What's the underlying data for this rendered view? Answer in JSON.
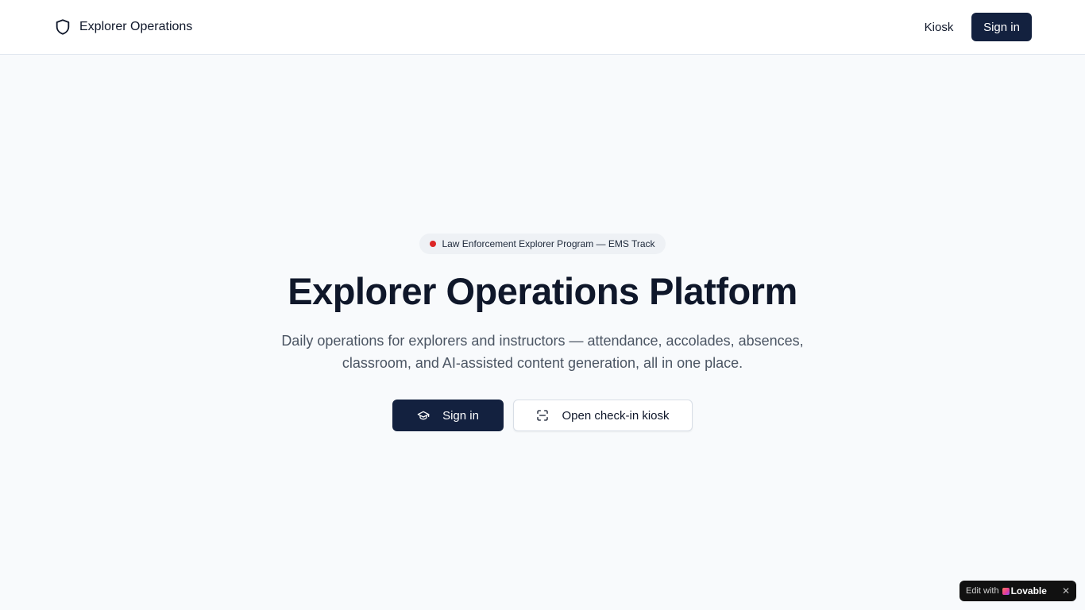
{
  "header": {
    "brand_name": "Explorer Operations",
    "brand_icon": "shield-icon",
    "nav": {
      "kiosk_label": "Kiosk",
      "signin_label": "Sign in"
    }
  },
  "hero": {
    "badge_text": "Law Enforcement Explorer Program — EMS Track",
    "badge_dot_color": "#dc2626",
    "title": "Explorer Operations Platform",
    "subtitle": "Daily operations for explorers and instructors — attendance, accolades, absences, classroom, and AI-assisted content generation, all in one place.",
    "primary_button": {
      "label": "Sign in",
      "icon": "graduation-cap-icon"
    },
    "secondary_button": {
      "label": "Open check-in kiosk",
      "icon": "scan-icon"
    }
  },
  "lovable_badge": {
    "prefix": "Edit with",
    "brand": "Lovable",
    "close_glyph": "✕"
  },
  "colors": {
    "primary": "#13213f",
    "background": "#f8fafc",
    "text": "#0f172a",
    "muted_text": "#4b5563"
  }
}
